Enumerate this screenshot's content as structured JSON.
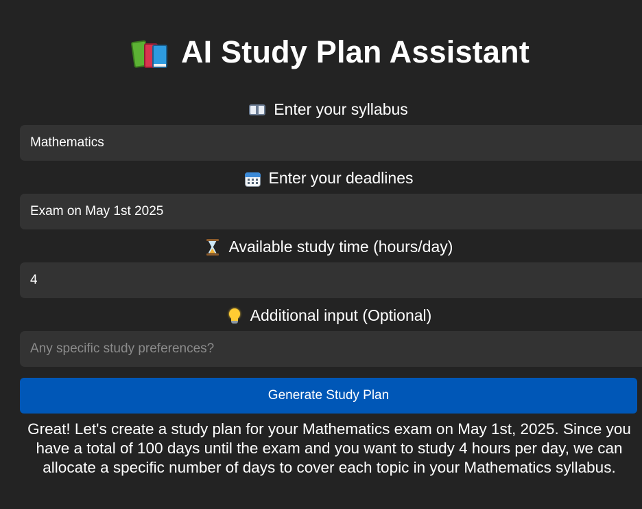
{
  "header": {
    "icon": "books-icon",
    "title": "AI Study Plan Assistant"
  },
  "fields": {
    "syllabus": {
      "icon": "open-book-icon",
      "label": "Enter your syllabus",
      "value": "Mathematics",
      "placeholder": ""
    },
    "deadlines": {
      "icon": "calendar-icon",
      "label": "Enter your deadlines",
      "value": "Exam on May 1st 2025",
      "placeholder": ""
    },
    "study_time": {
      "icon": "hourglass-icon",
      "label": "Available study time (hours/day)",
      "value": "4",
      "placeholder": ""
    },
    "additional": {
      "icon": "light-bulb-icon",
      "label": "Additional input (Optional)",
      "value": "",
      "placeholder": "Any specific study preferences?"
    }
  },
  "actions": {
    "generate_label": "Generate Study Plan"
  },
  "result": {
    "text": "Great! Let's create a study plan for your Mathematics exam on May 1st, 2025. Since you have a total of 100 days until the exam and you want to study 4 hours per day, we can allocate a specific number of days to cover each topic in your Mathematics syllabus."
  },
  "colors": {
    "background": "#232323",
    "field_bg": "#333333",
    "button_bg": "#0057b7",
    "text": "#ffffff",
    "placeholder": "#8b8b8b"
  }
}
